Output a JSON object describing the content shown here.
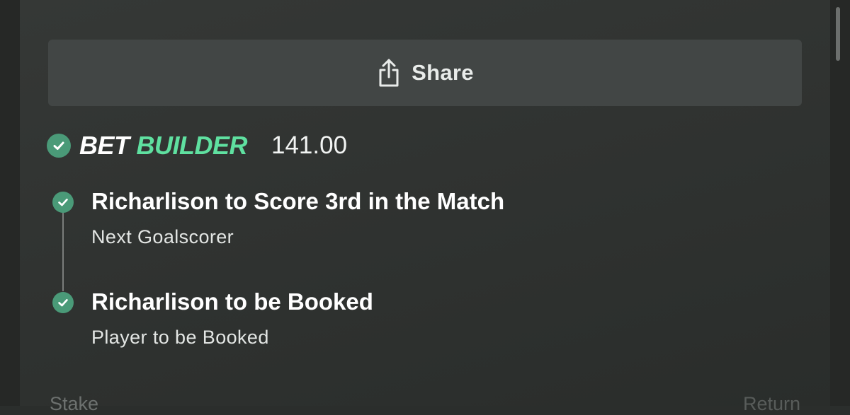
{
  "share": {
    "label": "Share",
    "icon": "share-icon"
  },
  "bet_builder": {
    "brand_bet": "BET",
    "brand_builder": "BUILDER",
    "odds": "141.00",
    "accent_color": "#5fe0a0",
    "check_color": "#4a9a78"
  },
  "selections": [
    {
      "title": "Richarlison to Score 3rd in the Match",
      "market": "Next Goalscorer"
    },
    {
      "title": "Richarlison to be Booked",
      "market": "Player to be Booked"
    }
  ],
  "footer": {
    "stake_label": "Stake",
    "return_label": "Return"
  }
}
